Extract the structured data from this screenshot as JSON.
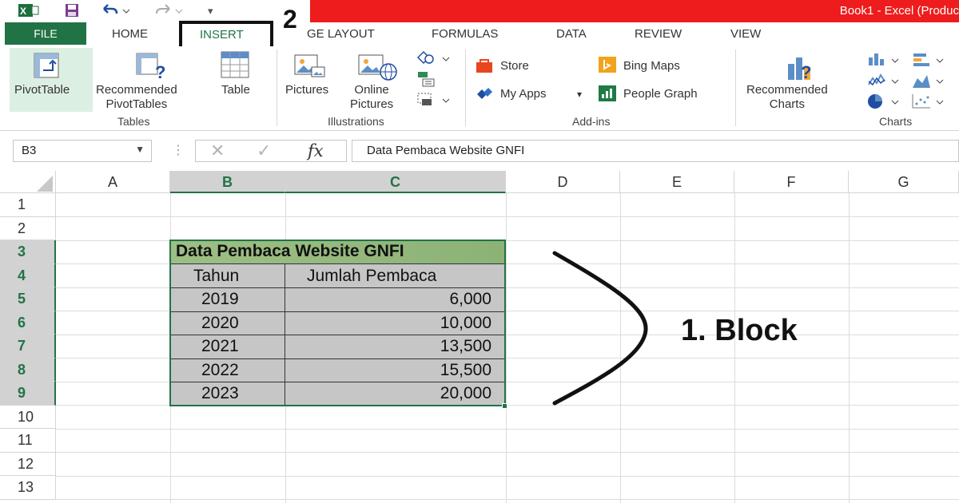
{
  "titlebar": {
    "title": "Book1 -  Excel (Produc"
  },
  "tabs": {
    "file": "FILE",
    "home": "HOME",
    "insert": "INSERT",
    "page_layout": "GE LAYOUT",
    "formulas": "FORMULAS",
    "data": "DATA",
    "review": "REVIEW",
    "view": "VIEW"
  },
  "annotations": {
    "step2": "2",
    "step1": "1. Block"
  },
  "ribbon": {
    "tables": {
      "label": "Tables",
      "pivottable": "PivotTable",
      "recommended_line1": "Recommended",
      "recommended_line2": "PivotTables",
      "table": "Table"
    },
    "illustrations": {
      "label": "Illustrations",
      "pictures": "Pictures",
      "online_line1": "Online",
      "online_line2": "Pictures"
    },
    "addins": {
      "label": "Add-ins",
      "store": "Store",
      "my_apps": "My Apps",
      "bing_maps": "Bing Maps",
      "people_graph": "People Graph"
    },
    "charts": {
      "label": "Charts",
      "recommended_line1": "Recommended",
      "recommended_line2": "Charts"
    }
  },
  "formula_bar": {
    "name_box": "B3",
    "fx": "fx",
    "content": "Data Pembaca Website GNFI"
  },
  "grid": {
    "columns": [
      "A",
      "B",
      "C",
      "D",
      "E",
      "F",
      "G"
    ],
    "rows": [
      "1",
      "2",
      "3",
      "4",
      "5",
      "6",
      "7",
      "8",
      "9",
      "10",
      "11",
      "12",
      "13"
    ]
  },
  "table": {
    "title": "Data Pembaca Website GNFI",
    "headers": [
      "Tahun",
      "Jumlah Pembaca"
    ],
    "rows": [
      [
        "2019",
        "6,000"
      ],
      [
        "2020",
        "10,000"
      ],
      [
        "2021",
        "13,500"
      ],
      [
        "2022",
        "15,500"
      ],
      [
        "2023",
        "20,000"
      ]
    ]
  },
  "colors": {
    "excel_green": "#217346",
    "title_red": "#ee1c1c",
    "header_fill": "#9dbf85",
    "data_fill": "#c6c6c6"
  }
}
